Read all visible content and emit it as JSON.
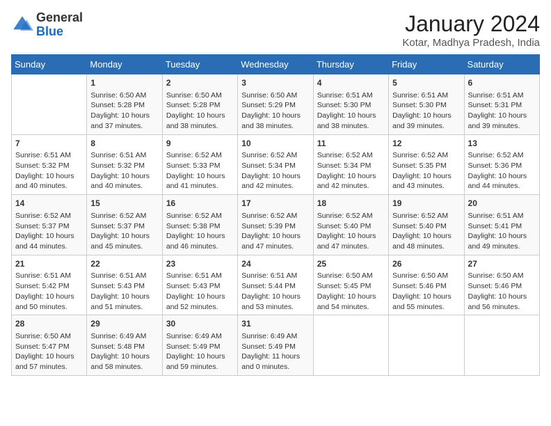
{
  "header": {
    "logo_general": "General",
    "logo_blue": "Blue",
    "title": "January 2024",
    "location": "Kotar, Madhya Pradesh, India"
  },
  "days_of_week": [
    "Sunday",
    "Monday",
    "Tuesday",
    "Wednesday",
    "Thursday",
    "Friday",
    "Saturday"
  ],
  "weeks": [
    [
      {
        "day": "",
        "info": ""
      },
      {
        "day": "1",
        "info": "Sunrise: 6:50 AM\nSunset: 5:28 PM\nDaylight: 10 hours\nand 37 minutes."
      },
      {
        "day": "2",
        "info": "Sunrise: 6:50 AM\nSunset: 5:28 PM\nDaylight: 10 hours\nand 38 minutes."
      },
      {
        "day": "3",
        "info": "Sunrise: 6:50 AM\nSunset: 5:29 PM\nDaylight: 10 hours\nand 38 minutes."
      },
      {
        "day": "4",
        "info": "Sunrise: 6:51 AM\nSunset: 5:30 PM\nDaylight: 10 hours\nand 38 minutes."
      },
      {
        "day": "5",
        "info": "Sunrise: 6:51 AM\nSunset: 5:30 PM\nDaylight: 10 hours\nand 39 minutes."
      },
      {
        "day": "6",
        "info": "Sunrise: 6:51 AM\nSunset: 5:31 PM\nDaylight: 10 hours\nand 39 minutes."
      }
    ],
    [
      {
        "day": "7",
        "info": "Sunrise: 6:51 AM\nSunset: 5:32 PM\nDaylight: 10 hours\nand 40 minutes."
      },
      {
        "day": "8",
        "info": "Sunrise: 6:51 AM\nSunset: 5:32 PM\nDaylight: 10 hours\nand 40 minutes."
      },
      {
        "day": "9",
        "info": "Sunrise: 6:52 AM\nSunset: 5:33 PM\nDaylight: 10 hours\nand 41 minutes."
      },
      {
        "day": "10",
        "info": "Sunrise: 6:52 AM\nSunset: 5:34 PM\nDaylight: 10 hours\nand 42 minutes."
      },
      {
        "day": "11",
        "info": "Sunrise: 6:52 AM\nSunset: 5:34 PM\nDaylight: 10 hours\nand 42 minutes."
      },
      {
        "day": "12",
        "info": "Sunrise: 6:52 AM\nSunset: 5:35 PM\nDaylight: 10 hours\nand 43 minutes."
      },
      {
        "day": "13",
        "info": "Sunrise: 6:52 AM\nSunset: 5:36 PM\nDaylight: 10 hours\nand 44 minutes."
      }
    ],
    [
      {
        "day": "14",
        "info": "Sunrise: 6:52 AM\nSunset: 5:37 PM\nDaylight: 10 hours\nand 44 minutes."
      },
      {
        "day": "15",
        "info": "Sunrise: 6:52 AM\nSunset: 5:37 PM\nDaylight: 10 hours\nand 45 minutes."
      },
      {
        "day": "16",
        "info": "Sunrise: 6:52 AM\nSunset: 5:38 PM\nDaylight: 10 hours\nand 46 minutes."
      },
      {
        "day": "17",
        "info": "Sunrise: 6:52 AM\nSunset: 5:39 PM\nDaylight: 10 hours\nand 47 minutes."
      },
      {
        "day": "18",
        "info": "Sunrise: 6:52 AM\nSunset: 5:40 PM\nDaylight: 10 hours\nand 47 minutes."
      },
      {
        "day": "19",
        "info": "Sunrise: 6:52 AM\nSunset: 5:40 PM\nDaylight: 10 hours\nand 48 minutes."
      },
      {
        "day": "20",
        "info": "Sunrise: 6:51 AM\nSunset: 5:41 PM\nDaylight: 10 hours\nand 49 minutes."
      }
    ],
    [
      {
        "day": "21",
        "info": "Sunrise: 6:51 AM\nSunset: 5:42 PM\nDaylight: 10 hours\nand 50 minutes."
      },
      {
        "day": "22",
        "info": "Sunrise: 6:51 AM\nSunset: 5:43 PM\nDaylight: 10 hours\nand 51 minutes."
      },
      {
        "day": "23",
        "info": "Sunrise: 6:51 AM\nSunset: 5:43 PM\nDaylight: 10 hours\nand 52 minutes."
      },
      {
        "day": "24",
        "info": "Sunrise: 6:51 AM\nSunset: 5:44 PM\nDaylight: 10 hours\nand 53 minutes."
      },
      {
        "day": "25",
        "info": "Sunrise: 6:50 AM\nSunset: 5:45 PM\nDaylight: 10 hours\nand 54 minutes."
      },
      {
        "day": "26",
        "info": "Sunrise: 6:50 AM\nSunset: 5:46 PM\nDaylight: 10 hours\nand 55 minutes."
      },
      {
        "day": "27",
        "info": "Sunrise: 6:50 AM\nSunset: 5:46 PM\nDaylight: 10 hours\nand 56 minutes."
      }
    ],
    [
      {
        "day": "28",
        "info": "Sunrise: 6:50 AM\nSunset: 5:47 PM\nDaylight: 10 hours\nand 57 minutes."
      },
      {
        "day": "29",
        "info": "Sunrise: 6:49 AM\nSunset: 5:48 PM\nDaylight: 10 hours\nand 58 minutes."
      },
      {
        "day": "30",
        "info": "Sunrise: 6:49 AM\nSunset: 5:49 PM\nDaylight: 10 hours\nand 59 minutes."
      },
      {
        "day": "31",
        "info": "Sunrise: 6:49 AM\nSunset: 5:49 PM\nDaylight: 11 hours\nand 0 minutes."
      },
      {
        "day": "",
        "info": ""
      },
      {
        "day": "",
        "info": ""
      },
      {
        "day": "",
        "info": ""
      }
    ]
  ]
}
